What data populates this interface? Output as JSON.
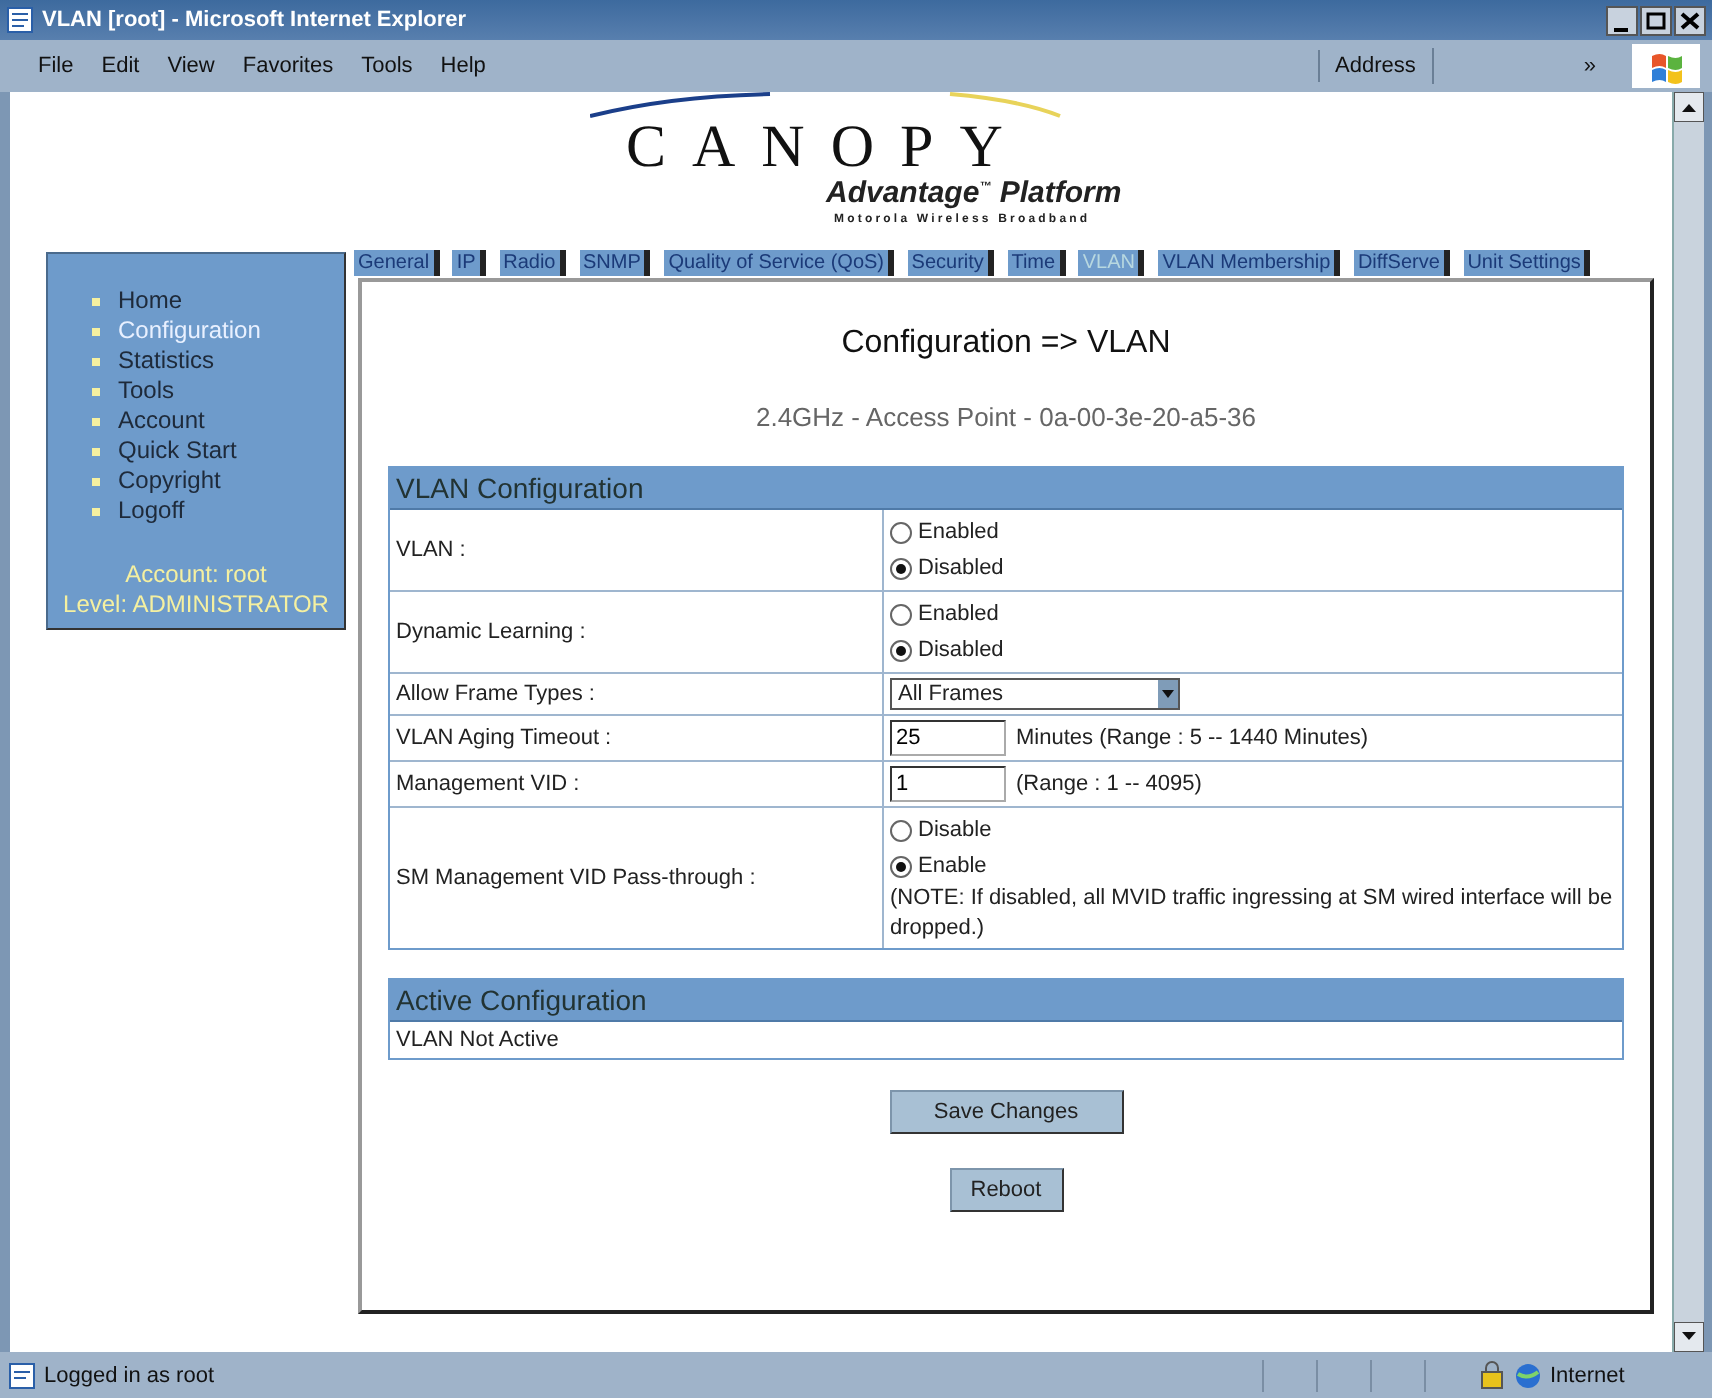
{
  "window": {
    "title": "VLAN [root] - Microsoft Internet Explorer"
  },
  "menu": [
    "File",
    "Edit",
    "View",
    "Favorites",
    "Tools",
    "Help"
  ],
  "toolbar": {
    "address_label": "Address",
    "chevron": "»"
  },
  "logo": {
    "name": "CANOPY",
    "tagline": "Advantage$^{™}$ Platform",
    "subtitle": "Motorola Wireless Broadband"
  },
  "sidebar": {
    "items": [
      {
        "label": "Home",
        "selected": false
      },
      {
        "label": "Configuration",
        "selected": true
      },
      {
        "label": "Statistics",
        "selected": false
      },
      {
        "label": "Tools",
        "selected": false
      },
      {
        "label": "Account",
        "selected": false
      },
      {
        "label": "Quick Start",
        "selected": false
      },
      {
        "label": "Copyright",
        "selected": false
      },
      {
        "label": "Logoff",
        "selected": false
      }
    ],
    "account": "Account: root",
    "level": "Level: ADMINISTRATOR"
  },
  "tabs": [
    {
      "label": "General",
      "selected": false
    },
    {
      "label": "IP",
      "selected": false
    },
    {
      "label": "Radio",
      "selected": false
    },
    {
      "label": "SNMP",
      "selected": false
    },
    {
      "label": "Quality of Service (QoS)",
      "selected": false
    },
    {
      "label": "Security",
      "selected": false
    },
    {
      "label": "Time",
      "selected": false
    },
    {
      "label": "VLAN",
      "selected": true
    },
    {
      "label": "VLAN Membership",
      "selected": false
    },
    {
      "label": "DiffServe",
      "selected": false
    },
    {
      "label": "Unit Settings",
      "selected": false
    }
  ],
  "page": {
    "title": "Configuration => VLAN",
    "device": "2.4GHz - Access Point - 0a-00-3e-20-a5-36"
  },
  "vlan_configuration": {
    "title": "VLAN Configuration",
    "rows": [
      {
        "kind": "radio",
        "label": "VLAN :",
        "options": [
          {
            "label": "Enabled",
            "selected": false
          },
          {
            "label": "Disabled",
            "selected": true
          }
        ]
      },
      {
        "kind": "radio",
        "label": "Dynamic Learning :",
        "options": [
          {
            "label": "Enabled",
            "selected": false
          },
          {
            "label": "Disabled",
            "selected": true
          }
        ]
      },
      {
        "kind": "select",
        "label": "Allow Frame Types :",
        "value": "All Frames"
      },
      {
        "kind": "input",
        "label": "VLAN Aging Timeout :",
        "value": "25",
        "note": "Minutes (Range : 5 -- 1440 Minutes)"
      },
      {
        "kind": "input",
        "label": "Management VID :",
        "value": "1",
        "note": "(Range : 1 -- 4095)"
      },
      {
        "kind": "radio",
        "label": "SM Management VID Pass-through :",
        "options": [
          {
            "label": "Disable",
            "selected": false
          },
          {
            "label": "Enable",
            "selected": true
          }
        ],
        "note": "(NOTE:  If disabled, all MVID traffic ingressing at SM wired interface will be dropped.)"
      }
    ]
  },
  "active_configuration": {
    "title": "Active Configuration",
    "text": "VLAN Not Active"
  },
  "buttons": [
    "Save Changes",
    "Reboot"
  ],
  "status_bar": {
    "text": "Logged in as root",
    "zone": "Internet"
  }
}
